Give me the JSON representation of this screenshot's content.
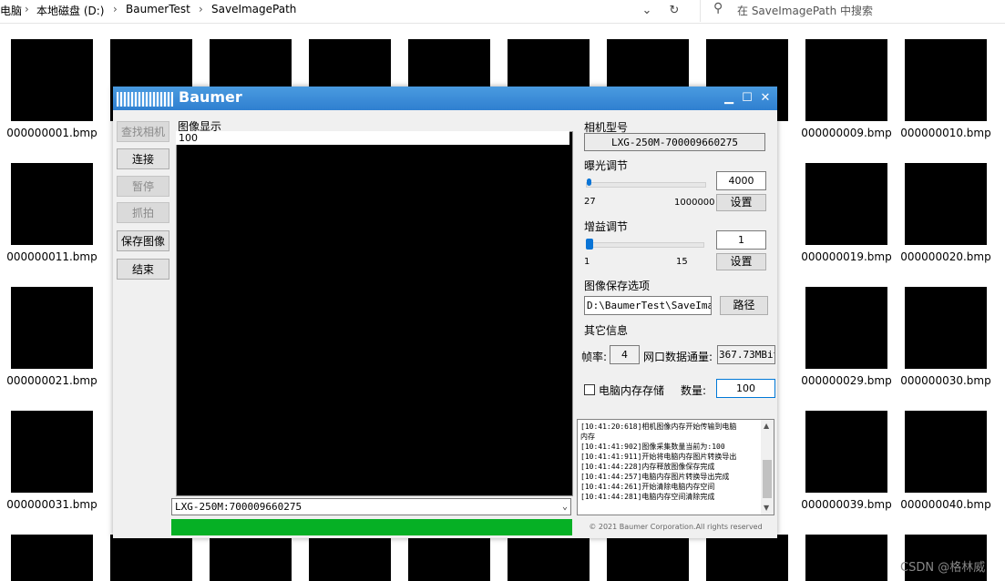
{
  "explorer": {
    "breadcrumb": [
      "电脑",
      "本地磁盘 (D:)",
      "BaumerTest",
      "SaveImagePath"
    ],
    "search_placeholder": "在 SaveImagePath 中搜索",
    "files_col1": [
      "000000001.bmp",
      "000000011.bmp",
      "000000021.bmp",
      "000000031.bmp"
    ],
    "files_col9": [
      "000000009.bmp",
      "000000019.bmp",
      "000000029.bmp",
      "000000039.bmp"
    ],
    "files_col10": [
      "000000010.bmp",
      "000000020.bmp",
      "000000030.bmp",
      "000000040.bmp"
    ]
  },
  "watermark": "CSDN @格林威",
  "app": {
    "title": "Baumer",
    "side_buttons": [
      "查找相机",
      "连接",
      "暂停",
      "抓拍",
      "保存图像",
      "结束"
    ],
    "display_label": "图像显示",
    "display_value": "100",
    "camera_select": "LXG-250M:700009660275",
    "camera_model_label": "相机型号",
    "camera_model": "LXG-250M-700009660275",
    "exposure": {
      "label": "曝光调节",
      "value": "4000",
      "min": "27",
      "max": "1000000",
      "set": "设置",
      "level": 0.004
    },
    "gain": {
      "label": "增益调节",
      "value": "1",
      "min": "1",
      "max": "15",
      "set": "设置",
      "level": 0.0
    },
    "save_option": {
      "label": "图像保存选项",
      "path": "D:\\BaumerTest\\SaveImagePath",
      "path_button": "路径"
    },
    "other": {
      "label": "其它信息",
      "fps_label": "帧率:",
      "fps": "4",
      "bandwidth_label": "网口数据通量:",
      "bandwidth": "367.73MBit/s",
      "mem_checkbox": "电脑内存存储",
      "count_label": "数量:",
      "count": "100"
    },
    "log": [
      "[10:41:20:618]相机图像内存开始传输到电脑",
      "内存",
      "[10:41:41:902]图像采集数量当前为:100",
      "[10:41:41:911]开始将电脑内存图片转换导出",
      "[10:41:44:228]内存释放图像保存完成",
      "[10:41:44:257]电脑内存图片转换导出完成",
      "[10:41:44:261]开始清除电脑内存空间",
      "[10:41:44:281]电脑内存空间清除完成"
    ],
    "copyright": "© 2021 Baumer Corporation.All rights reserved"
  }
}
